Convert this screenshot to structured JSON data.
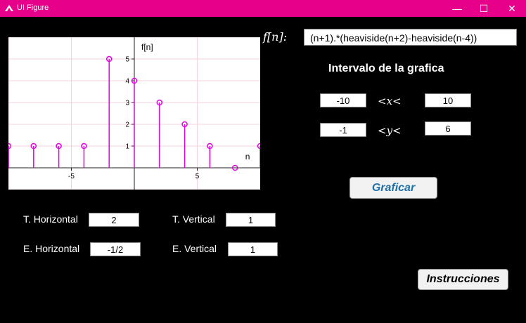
{
  "window": {
    "title": "UI Figure",
    "minimize": "—",
    "maximize": "☐",
    "close": "✕"
  },
  "formula": {
    "label": "f[n]:",
    "value": "(n+1).*(heaviside(n+2)-heaviside(n-4))"
  },
  "interval": {
    "heading": "Intervalo de la grafica",
    "x_min": "-10",
    "x_label": "<x<",
    "x_max": "10",
    "y_min": "-1",
    "y_label": "<y<",
    "y_max": "6"
  },
  "buttons": {
    "plot": "Graficar",
    "instructions": "Instrucciones"
  },
  "transform": {
    "h_shift_label": "T. Horizontal",
    "h_shift": "2",
    "v_shift_label": "T. Vertical",
    "v_shift": "1",
    "h_scale_label": "E. Horizontal",
    "h_scale": "-1/2",
    "v_scale_label": "E. Vertical",
    "v_scale": "1"
  },
  "colors": {
    "titlebar": "#e6008a",
    "stem": "#e600e6",
    "plot_button_text": "#1f6fa8"
  },
  "chart_data": {
    "type": "stem",
    "xlabel": "n",
    "ylabel": "f[n]",
    "xlim": [
      -10,
      10
    ],
    "ylim": [
      -1,
      6
    ],
    "x_ticks": [
      -5,
      5
    ],
    "y_ticks": [
      1,
      2,
      3,
      4,
      5
    ],
    "x": [
      -10,
      -8,
      -6,
      -4,
      -2,
      0,
      2,
      4,
      6,
      8,
      10
    ],
    "y": [
      1,
      1,
      1,
      1,
      5,
      4,
      3,
      2,
      1,
      0,
      1
    ],
    "grid": true
  }
}
